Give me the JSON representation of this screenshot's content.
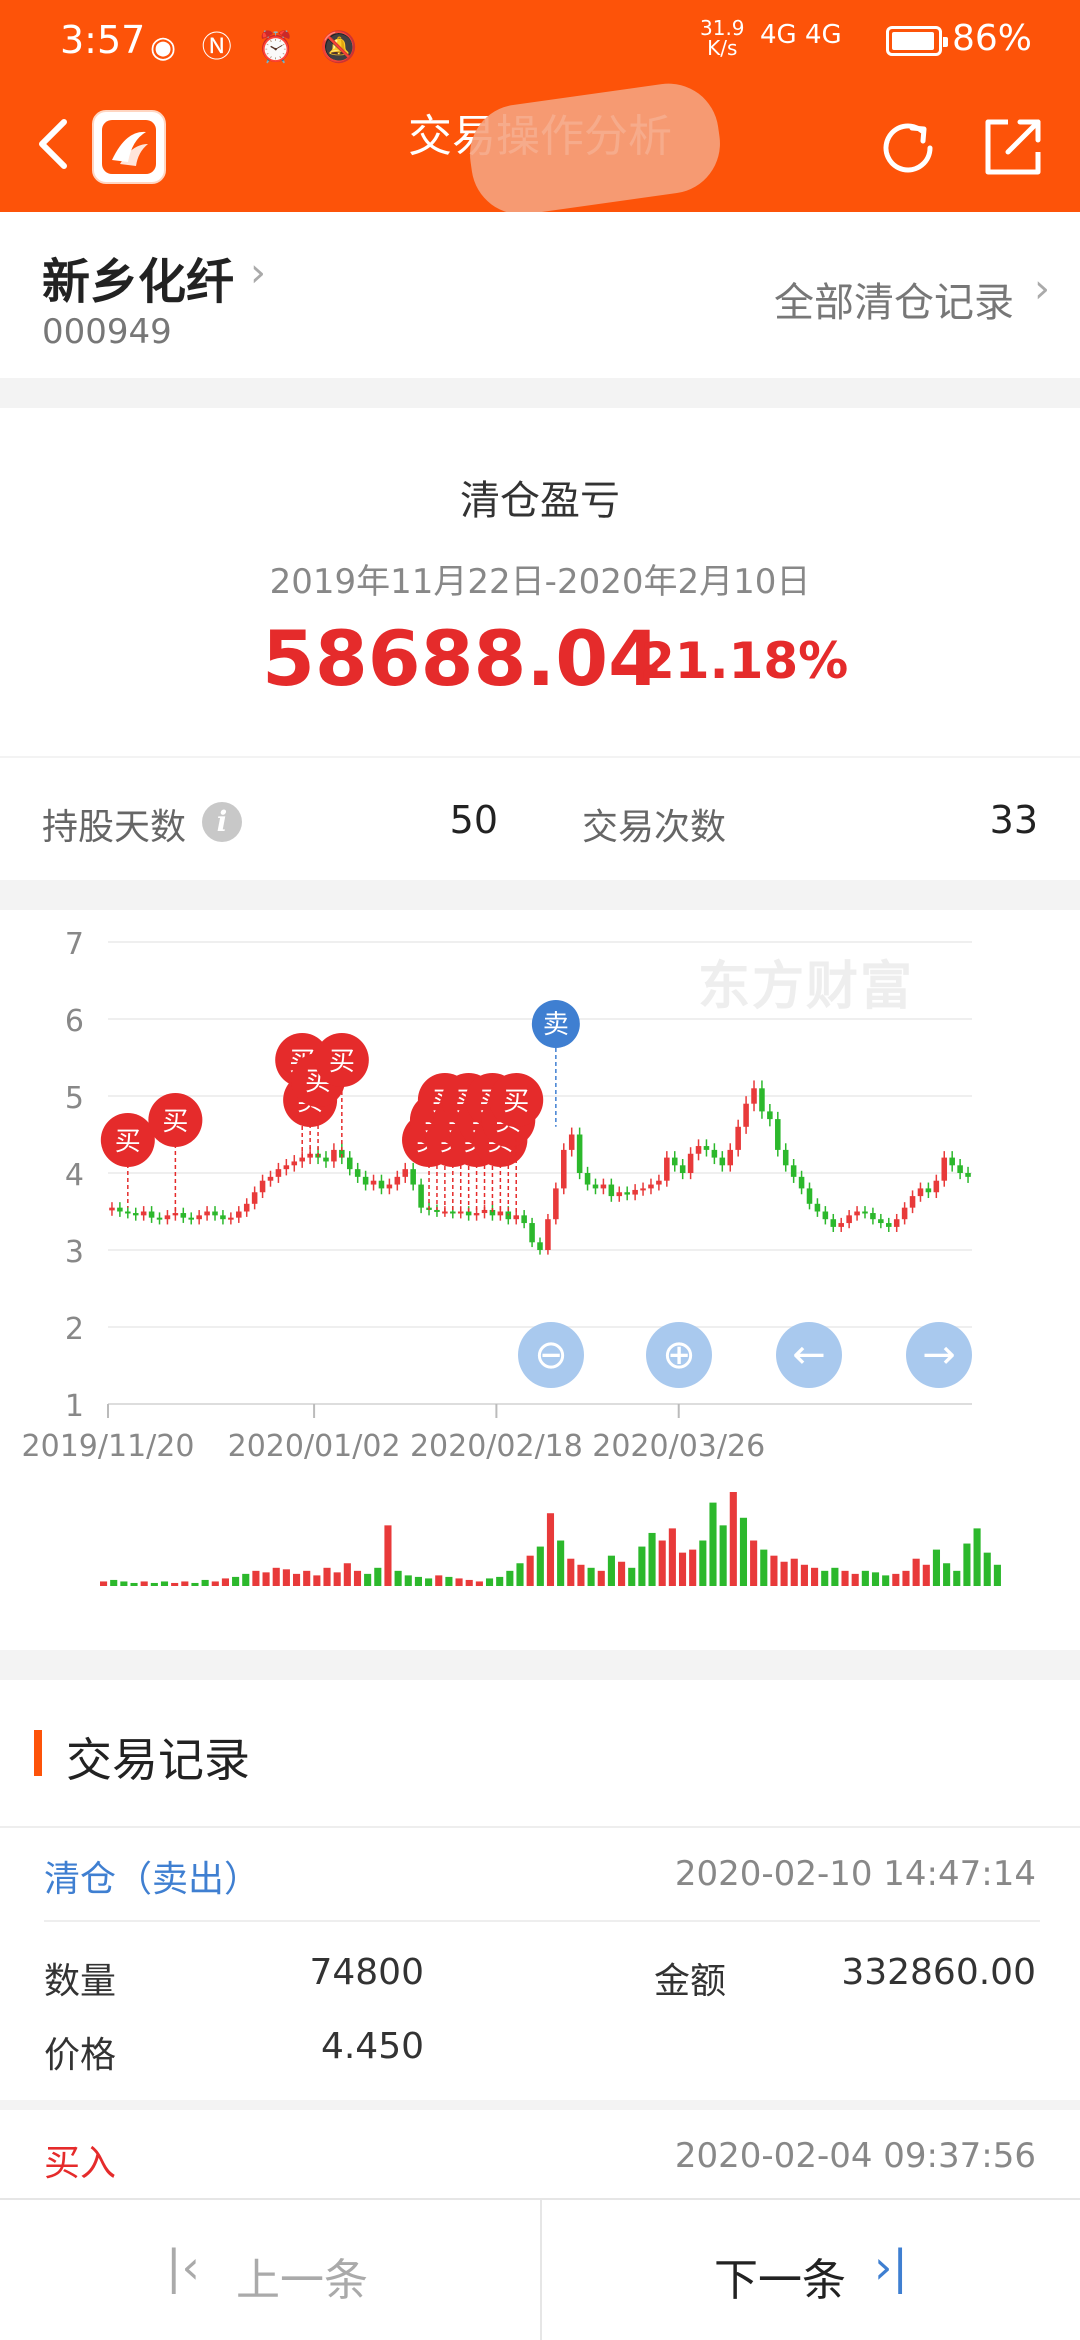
{
  "status_bar": {
    "time": "3:57",
    "net_speed": "31.9",
    "net_unit": "K/s",
    "signal": "4G 4G",
    "battery": "86%"
  },
  "header": {
    "title": "交易操作分析",
    "back_icon": "back-arrow-icon",
    "refresh_icon": "refresh-icon",
    "share_icon": "share-icon"
  },
  "stock": {
    "name": "新乡化纤",
    "code": "000949",
    "all_records_label": "全部清仓记录"
  },
  "summary": {
    "title": "清仓盈亏",
    "date_range": "2019年11月22日-2020年2月10日",
    "profit": "58688.04",
    "profit_pct": "21.18%",
    "holding_days_label": "持股天数",
    "holding_days": "50",
    "trade_count_label": "交易次数",
    "trade_count": "33"
  },
  "chart_data": {
    "type": "candlestick",
    "watermark": "东方财富",
    "y_ticks": [
      "7",
      "6",
      "5",
      "4",
      "3",
      "2",
      "1"
    ],
    "ylim": [
      1,
      7
    ],
    "x_ticks": [
      "2019/11/20",
      "2020/01/02",
      "2020/02/18",
      "2020/03/26"
    ],
    "buy_label": "买",
    "sell_label": "卖",
    "colors": {
      "up": "#e83a3a",
      "down": "#2cb82c",
      "buy": "#e52b2b",
      "sell": "#3f7fd1",
      "grid": "#efefef"
    },
    "price_path": [
      3.55,
      3.5,
      3.48,
      3.45,
      3.5,
      3.42,
      3.4,
      3.45,
      3.48,
      3.42,
      3.4,
      3.45,
      3.5,
      3.45,
      3.4,
      3.42,
      3.5,
      3.6,
      3.75,
      3.9,
      3.95,
      4.05,
      4.1,
      4.15,
      4.2,
      4.25,
      4.2,
      4.15,
      4.3,
      4.2,
      4.05,
      3.95,
      3.85,
      3.9,
      3.8,
      3.85,
      3.95,
      4.05,
      3.85,
      3.55,
      3.52,
      3.5,
      3.5,
      3.48,
      3.5,
      3.45,
      3.48,
      3.52,
      3.45,
      3.5,
      3.4,
      3.45,
      3.35,
      3.1,
      3.0,
      3.4,
      3.8,
      4.3,
      4.5,
      4.0,
      3.85,
      3.8,
      3.85,
      3.7,
      3.75,
      3.72,
      3.78,
      3.8,
      3.85,
      3.9,
      4.2,
      4.1,
      4.0,
      4.25,
      4.35,
      4.3,
      4.2,
      4.1,
      4.3,
      4.6,
      4.9,
      5.1,
      4.8,
      4.7,
      4.3,
      4.1,
      3.95,
      3.8,
      3.6,
      3.5,
      3.4,
      3.3,
      3.35,
      3.45,
      3.5,
      3.48,
      3.4,
      3.35,
      3.3,
      3.4,
      3.55,
      3.7,
      3.8,
      3.75,
      3.9,
      4.2,
      4.1,
      4.0,
      3.95
    ],
    "volumes": [
      3,
      4,
      3,
      2,
      3,
      2,
      3,
      2,
      3,
      2,
      4,
      3,
      5,
      6,
      8,
      10,
      9,
      12,
      11,
      8,
      10,
      7,
      12,
      9,
      15,
      10,
      8,
      12,
      40,
      10,
      7,
      6,
      5,
      7,
      6,
      5,
      4,
      3,
      5,
      6,
      10,
      15,
      20,
      26,
      48,
      30,
      18,
      14,
      12,
      10,
      20,
      16,
      12,
      26,
      35,
      30,
      38,
      22,
      24,
      30,
      55,
      40,
      62,
      45,
      30,
      24,
      20,
      16,
      18,
      14,
      12,
      10,
      12,
      10,
      8,
      10,
      9,
      7,
      8,
      10,
      18,
      14,
      24,
      15,
      10,
      28,
      38,
      22,
      14
    ],
    "buy_markers": [
      {
        "i": 2,
        "price": 3.55
      },
      {
        "i": 8,
        "price": 3.45
      },
      {
        "i": 24,
        "price": 4.2
      },
      {
        "i": 25,
        "price": 4.2
      },
      {
        "i": 26,
        "price": 4.2
      },
      {
        "i": 29,
        "price": 4.2
      },
      {
        "i": 40,
        "price": 3.52
      },
      {
        "i": 41,
        "price": 3.52
      },
      {
        "i": 42,
        "price": 3.5
      },
      {
        "i": 43,
        "price": 3.5
      },
      {
        "i": 44,
        "price": 3.5
      },
      {
        "i": 45,
        "price": 3.48
      },
      {
        "i": 46,
        "price": 3.5
      },
      {
        "i": 47,
        "price": 3.5
      },
      {
        "i": 48,
        "price": 3.48
      },
      {
        "i": 49,
        "price": 3.5
      },
      {
        "i": 50,
        "price": 3.45
      },
      {
        "i": 51,
        "price": 3.45
      }
    ],
    "sell_markers": [
      {
        "i": 56,
        "price": 4.6
      }
    ],
    "buttons": [
      "zoom-out-icon",
      "zoom-in-icon",
      "arrow-left-icon",
      "arrow-right-icon"
    ]
  },
  "records": {
    "title": "交易记录",
    "first": {
      "type": "清仓（卖出）",
      "time": "2020-02-10 14:47:14",
      "qty_label": "数量",
      "qty": "74800",
      "amount_label": "金额",
      "amount": "332860.00",
      "price_label": "价格",
      "price": "4.450"
    },
    "second": {
      "type": "买入",
      "time": "2020-02-04 09:37:56"
    }
  },
  "footer": {
    "prev_label": "上一条",
    "next_label": "下一条"
  }
}
